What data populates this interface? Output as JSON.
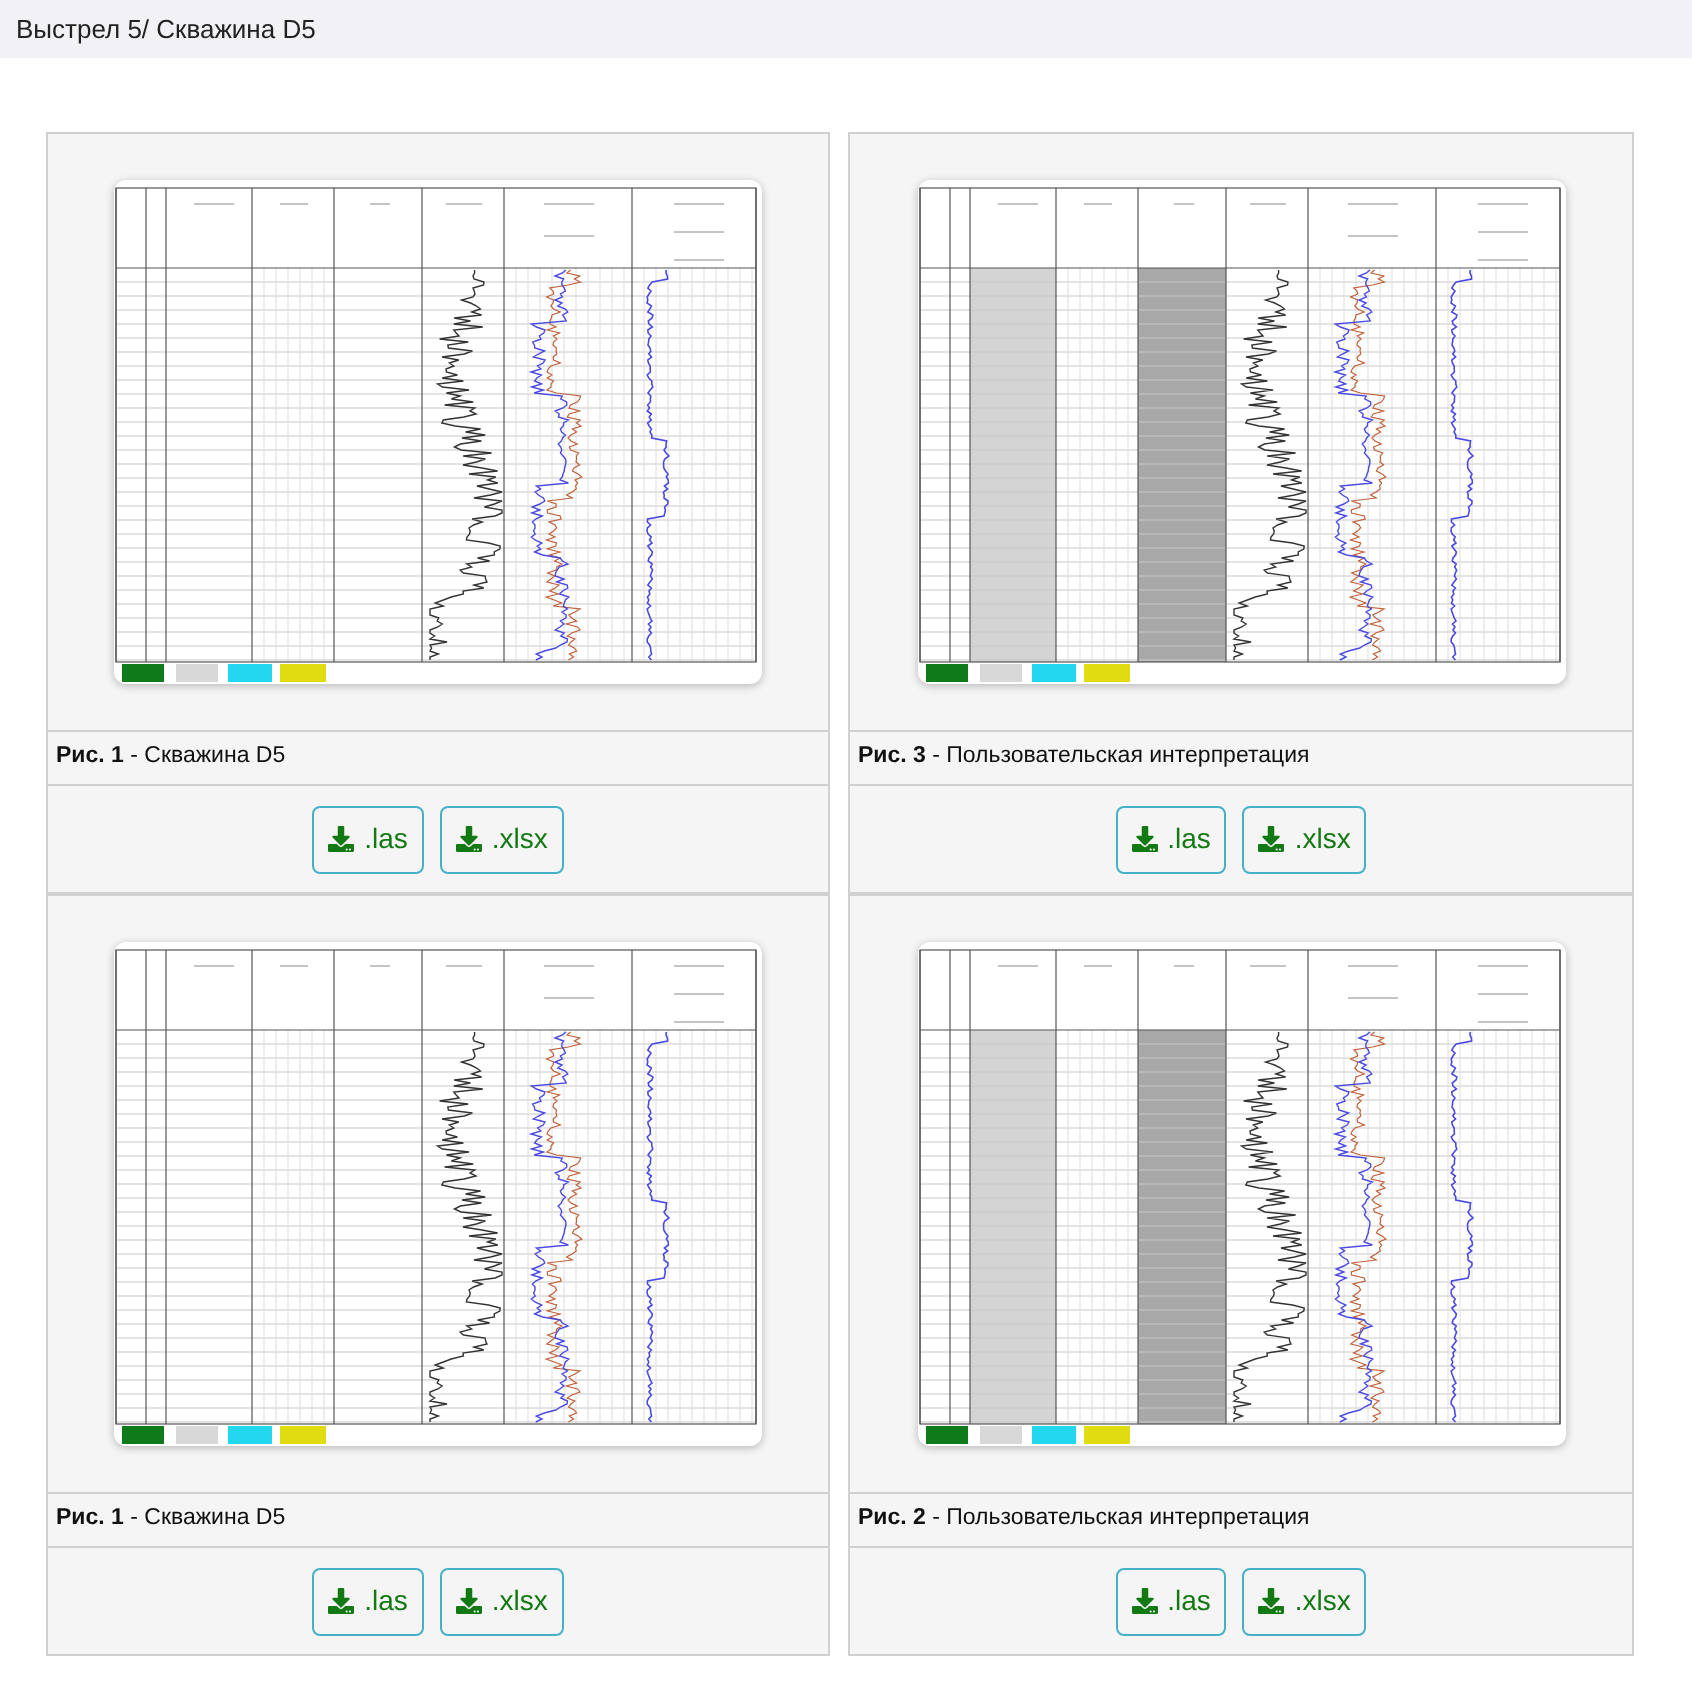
{
  "header": {
    "title": "Выстрел 5/ Скважина D5"
  },
  "figures": [
    {
      "kind": "plain",
      "caption": "**Рис. 1** - Скважина D5",
      "downloads": [
        {
          "label": ".las"
        },
        {
          "label": ".xlsx"
        }
      ]
    },
    {
      "kind": "shaded",
      "caption": "**Рис. 3** - Пользовательская интерпретация",
      "downloads": [
        {
          "label": ".las"
        },
        {
          "label": ".xlsx"
        }
      ]
    },
    {
      "kind": "plain",
      "caption": "**Рис. 1** - Скважина D5",
      "downloads": [
        {
          "label": ".las"
        },
        {
          "label": ".xlsx"
        }
      ]
    },
    {
      "kind": "shaded",
      "caption": "**Рис. 2** - Пользовательская интерпретация",
      "downloads": [
        {
          "label": ".las"
        },
        {
          "label": ".xlsx"
        }
      ]
    }
  ]
}
